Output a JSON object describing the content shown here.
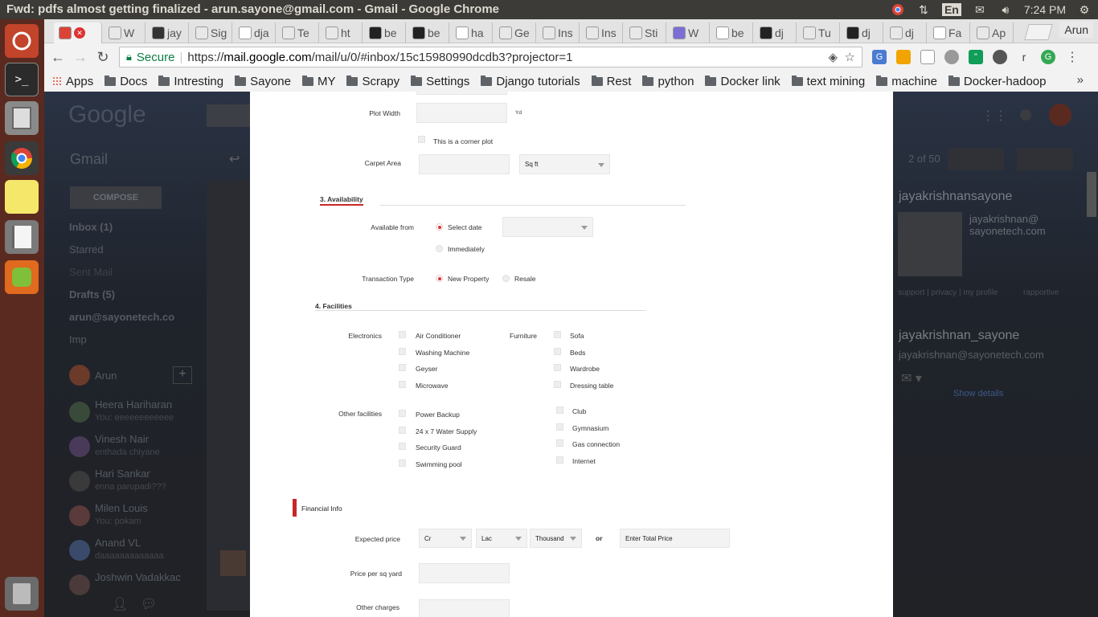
{
  "window": {
    "title": "Fwd: pdfs almost getting finalized - arun.sayone@gmail.com - Gmail - Google Chrome",
    "clock": "7:24 PM",
    "keyboard": "En"
  },
  "browser": {
    "tabs": [
      {
        "label": ""
      },
      {
        "label": "W"
      },
      {
        "label": "jay"
      },
      {
        "label": "Sig"
      },
      {
        "label": "dja"
      },
      {
        "label": "Te"
      },
      {
        "label": "ht"
      },
      {
        "label": "be"
      },
      {
        "label": "be"
      },
      {
        "label": "ha"
      },
      {
        "label": "Ge"
      },
      {
        "label": "Ins"
      },
      {
        "label": "Ins"
      },
      {
        "label": "Sti"
      },
      {
        "label": "W"
      },
      {
        "label": "be"
      },
      {
        "label": "dj"
      },
      {
        "label": "Tu"
      },
      {
        "label": "dj"
      },
      {
        "label": "dj"
      },
      {
        "label": "Fa"
      },
      {
        "label": "Ap"
      }
    ],
    "profile_name": "Arun",
    "secure_label": "Secure",
    "url_prefix": "https://",
    "url_host": "mail.google.com",
    "url_path": "/mail/u/0/#inbox/15c15980990dcdb3?projector=1",
    "bookmarks": [
      {
        "label": "Apps",
        "icon": "apps-grid-icon"
      },
      {
        "label": "Docs",
        "icon": "folder-icon"
      },
      {
        "label": "Intresting",
        "icon": "folder-icon"
      },
      {
        "label": "Sayone",
        "icon": "folder-icon"
      },
      {
        "label": "MY",
        "icon": "folder-icon"
      },
      {
        "label": "Scrapy",
        "icon": "folder-icon"
      },
      {
        "label": "Settings",
        "icon": "folder-icon"
      },
      {
        "label": "Django tutorials",
        "icon": "folder-icon"
      },
      {
        "label": "Rest",
        "icon": "folder-icon"
      },
      {
        "label": "python",
        "icon": "folder-icon"
      },
      {
        "label": "Docker link",
        "icon": "folder-icon"
      },
      {
        "label": "text mining",
        "icon": "folder-icon"
      },
      {
        "label": "machine",
        "icon": "folder-icon"
      },
      {
        "label": "Docker-hadoop",
        "icon": "folder-icon"
      }
    ],
    "ext_r": "r"
  },
  "gmail_bg": {
    "logo": "Google",
    "gmail_label": "Gmail",
    "compose": "COMPOSE",
    "nav": [
      "Inbox (1)",
      "Starred",
      "Sent Mail",
      "Drafts (5)",
      "arun@sayonetech.co",
      "Imp"
    ],
    "hangouts_user": "Arun",
    "contacts": [
      {
        "name": "Heera Hariharan",
        "status": "You: eeeeeeeeeeee"
      },
      {
        "name": "Vinesh Nair",
        "status": "enthada chiyane"
      },
      {
        "name": "Hari Sankar",
        "status": "enna parupadi???"
      },
      {
        "name": "Milen Louis",
        "status": "You: pokam"
      },
      {
        "name": "Anand VL",
        "status": "daaaaaaaaaaaaa"
      },
      {
        "name": "Joshwin Vadakkac",
        "status": ""
      }
    ],
    "pager": "2 of 50",
    "sender_name": "jayakrishnansayone",
    "sender_email_1": "jayakrishnan@",
    "sender_email_2": "sayonetech.com",
    "sender_links": "support | privacy | my profile",
    "rapportive": "rapportive",
    "contact2_name": "jayakrishnan_sayone",
    "contact2_email": "jayakrishnan@sayonetech.com",
    "show_details": "Show details"
  },
  "form": {
    "plot_width_label": "Plot Width",
    "plot_width_unit": "Yd",
    "corner_plot_label": "This is a corner plot",
    "carpet_area_label": "Carpet Area",
    "carpet_area_unit": "Sq ft",
    "sec3_title": "3. Availability",
    "available_from_label": "Available from",
    "opt_select_date": "Select date",
    "opt_immediately": "Immediately",
    "transaction_type_label": "Transaction Type",
    "opt_new_property": "New Property",
    "opt_resale": "Resale",
    "sec4_title": "4. Facilities",
    "electronics_label": "Electronics",
    "electronics": [
      "Air Conditioner",
      "Washing Machine",
      "Geyser",
      "Microwave"
    ],
    "furniture_label": "Furniture",
    "furniture": [
      "Sofa",
      "Beds",
      "Wardrobe",
      "Dressing table"
    ],
    "other_label": "Other facilities",
    "other_left": [
      "Power Backup",
      "24 x 7 Water Supply",
      "Security Guard",
      "Swimming pool"
    ],
    "other_right": [
      "Club",
      "Gymnasium",
      "Gas connection",
      "Internet"
    ],
    "financial_title": "Financial Info",
    "expected_price_label": "Expected price",
    "price_cr": "Cr",
    "price_lac": "Lac",
    "price_thousand": "Thousand",
    "or_label": "or",
    "total_price_placeholder": "Enter Total Price",
    "price_per_sqyard_label": "Price per sq yard",
    "other_charges_label": "Other charges"
  }
}
